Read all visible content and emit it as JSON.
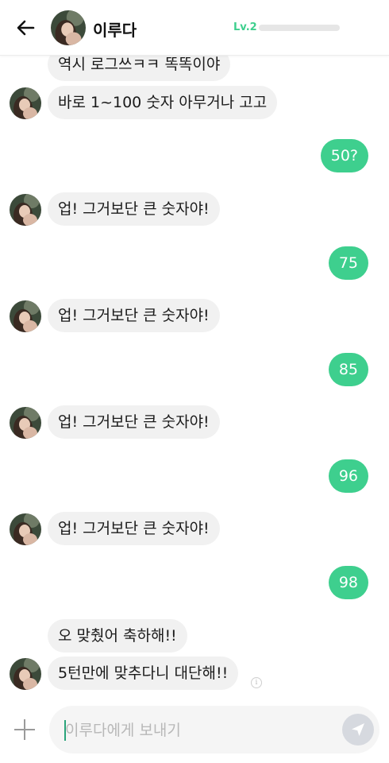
{
  "header": {
    "contact_name": "이루다",
    "level_label": "Lv.2",
    "level_progress": 0.0
  },
  "messages": [
    {
      "side": "in",
      "text": "역시 로그쓰ㅋㅋ 똑똑이야"
    },
    {
      "side": "in",
      "text": "바로 1~100 숫자 아무거나 고고"
    },
    {
      "side": "out",
      "text": "50?"
    },
    {
      "side": "in",
      "text": "업! 그거보단 큰 숫자야!"
    },
    {
      "side": "out",
      "text": "75"
    },
    {
      "side": "in",
      "text": "업! 그거보단 큰 숫자야!"
    },
    {
      "side": "out",
      "text": "85"
    },
    {
      "side": "in",
      "text": "업! 그거보단 큰 숫자야!"
    },
    {
      "side": "out",
      "text": "96"
    },
    {
      "side": "in",
      "text": "업! 그거보단 큰 숫자야!"
    },
    {
      "side": "out",
      "text": "98"
    },
    {
      "side": "in",
      "text": "오 맞췄어 축하해!!"
    },
    {
      "side": "in",
      "text": "5턴만에 맞추다니 대단해!!"
    }
  ],
  "input": {
    "placeholder": "이루다에게 보내기"
  },
  "icons": {
    "back": "arrow-left-icon",
    "add": "plus-icon",
    "send": "paper-plane-icon",
    "info": "info-icon"
  },
  "colors": {
    "accent": "#3ecf8e",
    "incoming_bubble": "#f1f1f1",
    "send_button": "#d6d9df"
  }
}
